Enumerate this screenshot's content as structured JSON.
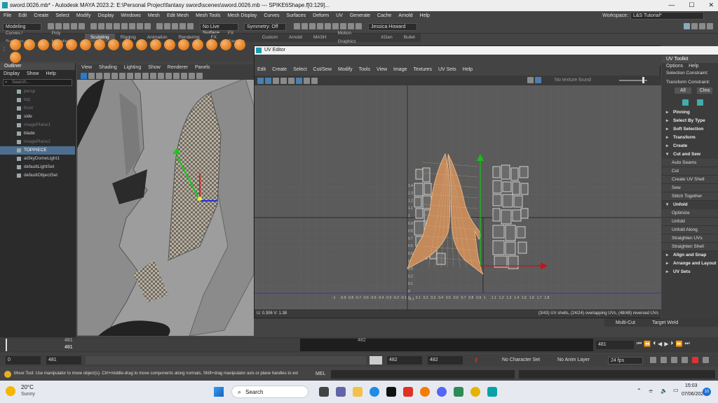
{
  "window": {
    "title": "sword.0026.mb* - Autodesk MAYA 2023.2: E:\\Personal Project\\fantasy sword\\scenes\\sword.0026.mb  ---  SPIKE6Shape.f[0:129]...",
    "minimize": "—",
    "maximize": "☐",
    "close": "✕"
  },
  "menubar": [
    "File",
    "Edit",
    "Create",
    "Select",
    "Modify",
    "Display",
    "Windows",
    "Mesh",
    "Edit Mesh",
    "Mesh Tools",
    "Mesh Display",
    "Curves",
    "Surfaces",
    "Deform",
    "UV",
    "Generate",
    "Cache",
    "Arnold",
    "Help"
  ],
  "workspace": {
    "label": "Workspace:",
    "value": "L&S Tutorial*"
  },
  "statusline": {
    "mode": "Modeling",
    "live": "No Live Surface",
    "symmetry": "Symmetry: Off",
    "user": "Jessica Howard"
  },
  "shelf_tabs": [
    "Curves / Surfaces",
    "Poly Modeling",
    "Sculpting",
    "Rigging",
    "Animation",
    "Rendering",
    "FX",
    "FX Caching",
    "Custom",
    "Arnold",
    "MASH",
    "Motion Graphics",
    "XGen",
    "Bullet"
  ],
  "shelf_active": "Sculpting",
  "outliner": {
    "title": "Outliner",
    "menu": [
      "Display",
      "Show",
      "Help"
    ],
    "search_placeholder": "Search...",
    "items": [
      {
        "label": "persp",
        "state": "dim"
      },
      {
        "label": "top",
        "state": "dim"
      },
      {
        "label": "front",
        "state": "dim"
      },
      {
        "label": "side",
        "state": "normal"
      },
      {
        "label": "imagePlane1",
        "state": "dim"
      },
      {
        "label": "blade",
        "state": "normal"
      },
      {
        "label": "imagePlane2",
        "state": "dim"
      },
      {
        "label": "TOPPIECE",
        "state": "selected"
      },
      {
        "label": "aiSkyDomeLight1",
        "state": "normal"
      },
      {
        "label": "defaultLightSet",
        "state": "normal"
      },
      {
        "label": "defaultObjectSet",
        "state": "normal"
      }
    ]
  },
  "viewport_menu": [
    "View",
    "Shading",
    "Lighting",
    "Show",
    "Renderer",
    "Panels"
  ],
  "uv_editor": {
    "title": "UV Editor",
    "menu": [
      "Edit",
      "Create",
      "Select",
      "Cut/Sew",
      "Modify",
      "Tools",
      "View",
      "Image",
      "Textures",
      "UV Sets",
      "Help"
    ],
    "texture": "No texture found",
    "coords": "U: 0.306  V: 1.38",
    "info": "(3/43) UV shells, (24/24) overlapping UVs, (48/48) reversed UVs",
    "xticks": [
      "-1",
      "-0.9",
      "-0.8",
      "-0.7",
      "-0.6",
      "-0.5",
      "-0.4",
      "-0.3",
      "-0.2",
      "-0.1",
      "0",
      "0.1",
      "0.2",
      "0.3",
      "0.4",
      "0.5",
      "0.6",
      "0.7",
      "0.8",
      "0.9",
      "1",
      "1.1",
      "1.2",
      "1.3",
      "1.4",
      "1.5",
      "1.6",
      "1.7",
      "1.8"
    ],
    "yticks": [
      "1.4",
      "1.3",
      "1.2",
      "1.1",
      "1",
      "0.9",
      "0.8",
      "0.7",
      "0.6",
      "0.5",
      "0.4",
      "0.3",
      "0.2",
      "0.1",
      "0",
      "-0.1"
    ]
  },
  "uv_toolkit": {
    "title": "UV Toolkit",
    "menu": [
      "Options",
      "Help"
    ],
    "selection_constraint": "Selection Constraint:",
    "transform_constraint": "Transform Constraint:",
    "all": "All",
    "clear": "Clea",
    "rows": [
      {
        "t": "sec",
        "label": "Pinning"
      },
      {
        "t": "sec",
        "label": "Select By Type"
      },
      {
        "t": "sec",
        "label": "Soft Selection"
      },
      {
        "t": "sec",
        "label": "Transform"
      },
      {
        "t": "sec",
        "label": "Create"
      },
      {
        "t": "secopen",
        "label": "Cut and Sew"
      },
      {
        "t": "btn",
        "label": "Auto Seams"
      },
      {
        "t": "btn",
        "label": "Cut"
      },
      {
        "t": "btn",
        "label": "Create UV Shell"
      },
      {
        "t": "btn",
        "label": "Sew"
      },
      {
        "t": "btn",
        "label": "Stitch Together"
      },
      {
        "t": "secopen",
        "label": "Unfold"
      },
      {
        "t": "btn",
        "label": "Optimize"
      },
      {
        "t": "btn",
        "label": "Unfold"
      },
      {
        "t": "btn",
        "label": "Unfold Along"
      },
      {
        "t": "btn",
        "label": "Straighten UVs"
      },
      {
        "t": "btn",
        "label": "Straighten Shell"
      },
      {
        "t": "sec",
        "label": "Align and Snap"
      },
      {
        "t": "sec",
        "label": "Arrange and Layout"
      },
      {
        "t": "sec",
        "label": "UV Sets"
      }
    ],
    "multicut": "Multi-Cut",
    "target_weld": "Target Weld"
  },
  "timeline": {
    "current": "481",
    "marker": "481",
    "mid": "482",
    "end_field": "481"
  },
  "range": {
    "start": "0",
    "a": "481",
    "b": "482",
    "c": "482",
    "char_set": "No Character Set",
    "anim_layer": "No Anim Layer",
    "fps": "24 fps"
  },
  "help_line": "Move Tool: Use manipulator to move object(s). Ctrl+middle-drag to move components along normals. Shift+drag manipulator axis or plane handles to ext",
  "mel": "MEL",
  "taskbar": {
    "temp": "20°C",
    "weather": "Sunny",
    "search": "Search",
    "time": "15:03",
    "date": "07/06/2023",
    "notif": "10"
  }
}
